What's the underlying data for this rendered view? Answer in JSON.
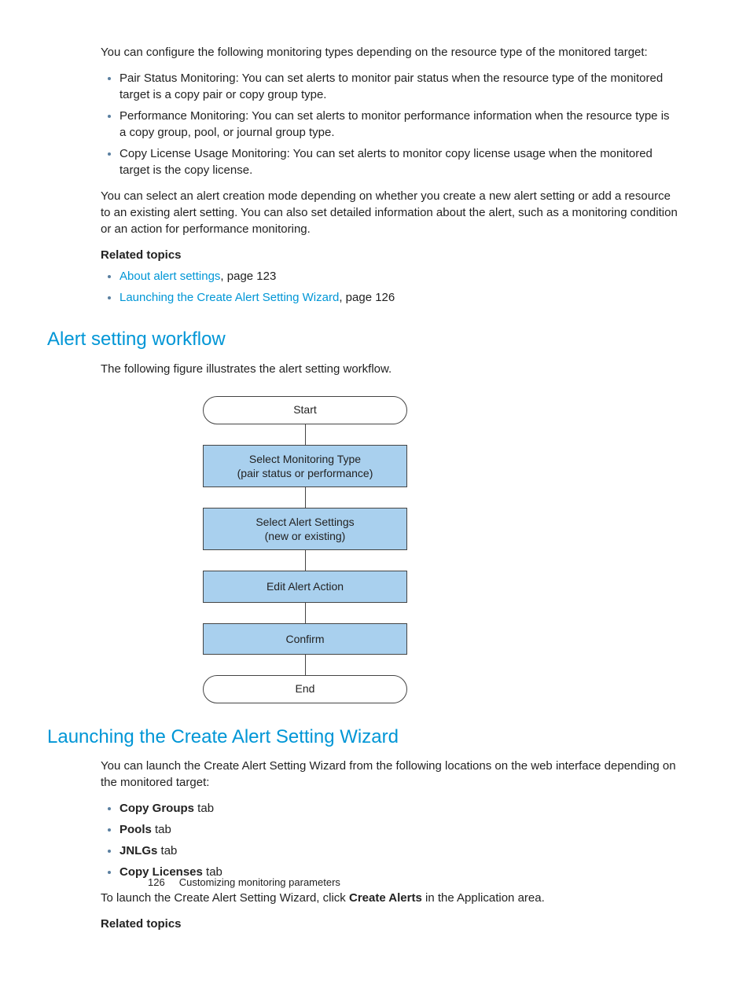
{
  "intro": "You can configure the following monitoring types depending on the resource type of the monitored target:",
  "monitoring_types": [
    "Pair Status Monitoring: You can set alerts to monitor pair status when the resource type of the monitored target is a copy pair or copy group type.",
    "Performance Monitoring: You can set alerts to monitor performance information when the resource type is a copy group, pool, or journal group type.",
    "Copy License Usage Monitoring: You can set alerts to monitor copy license usage when the monitored target is the copy license."
  ],
  "select_mode": "You can select an alert creation mode depending on whether you create a new alert setting or add a resource to an existing alert setting. You can also set detailed information about the alert, such as a monitoring condition or an action for performance monitoring.",
  "related_topics_label": "Related topics",
  "related1": [
    {
      "link": "About alert settings",
      "suffix": ", page 123"
    },
    {
      "link": "Launching the Create Alert Setting Wizard",
      "suffix": ", page 126"
    }
  ],
  "heading_workflow": "Alert setting workflow",
  "workflow_intro": "The following figure illustrates the alert setting workflow.",
  "flowchart": {
    "start": "Start",
    "step1a": "Select Monitoring Type",
    "step1b": "(pair status or performance)",
    "step2a": "Select Alert Settings",
    "step2b": "(new or existing)",
    "step3": "Edit Alert Action",
    "step4": "Confirm",
    "end": "End"
  },
  "heading_launch": "Launching the Create Alert Setting Wizard",
  "launch_intro": "You can launch the Create Alert Setting Wizard from the following locations on the web interface depending on the monitored target:",
  "tabs": [
    {
      "bold": "Copy Groups",
      "suffix": " tab"
    },
    {
      "bold": "Pools",
      "suffix": " tab"
    },
    {
      "bold": "JNLGs",
      "suffix": " tab"
    },
    {
      "bold": "Copy Licenses",
      "suffix": " tab"
    }
  ],
  "launch_action_pre": "To launch the Create Alert Setting Wizard, click ",
  "launch_action_bold": "Create Alerts",
  "launch_action_post": " in the Application area.",
  "footer_page": "126",
  "footer_text": "Customizing monitoring parameters"
}
